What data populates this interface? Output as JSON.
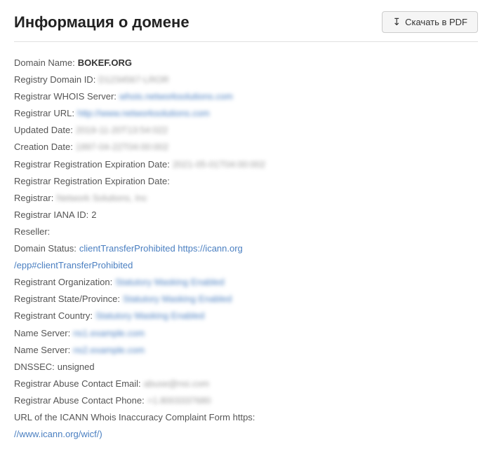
{
  "header": {
    "title": "Информация о домене",
    "download_button": "Скачать в PDF"
  },
  "whois": {
    "domain_name_label": "Domain Name:",
    "domain_name_value": "BOKEF.ORG",
    "registry_id_label": "Registry Domain ID:",
    "registry_id_value": "D1234567-LROR",
    "registrar_whois_label": "Registrar WHOIS Server:",
    "registrar_whois_value": "whois.networksolutions.com",
    "registrar_url_label": "Registrar URL:",
    "registrar_url_value": "http://www.networksolutions.com",
    "updated_date_label": "Updated Date:",
    "updated_date_value": "2019-11-20T13:54:022",
    "creation_date_label": "Creation Date:",
    "creation_date_value": "1997-04-22T04:00:002",
    "expiration_date_label1": "Registrar Registration Expiration Date:",
    "expiration_date_value1": "2021-05-01T04:00:002",
    "expiration_date_label2": "Registrar Registration Expiration Date:",
    "expiration_date_value2": "",
    "registrar_label": "Registrar:",
    "registrar_value": "Network Solutions, Inc",
    "iana_label": "Registrar IANA ID:",
    "iana_value": "2",
    "reseller_label": "Reseller:",
    "reseller_value": "",
    "domain_status_label": "Domain Status:",
    "domain_status_value": "clientTransferProhibited https://icann.org",
    "domain_status_value2": "/epp#clientTransferProhibited",
    "registrant_org_label": "Registrant Organization:",
    "registrant_org_value": "Statutory Masking Enabled",
    "registrant_state_label": "Registrant State/Province:",
    "registrant_state_value": "Statutory Masking Enabled",
    "registrant_country_label": "Registrant Country:",
    "registrant_country_value": "Statutory Masking Enabled",
    "name_server1_label": "Name Server:",
    "name_server1_value": "ns1.example.com",
    "name_server2_label": "Name Server:",
    "name_server2_value": "ns2.example.com",
    "dnssec_label": "DNSSEC:",
    "dnssec_value": "unsigned",
    "abuse_email_label": "Registrar Abuse Contact Email:",
    "abuse_email_value": "abuse@nsi.com",
    "abuse_phone_label": "Registrar Abuse Contact Phone:",
    "abuse_phone_value": "+1.8003337680",
    "icann_label": "URL of the ICANN Whois Inaccuracy Complaint Form https:",
    "icann_value": "//www.icann.org/wicf/)"
  }
}
